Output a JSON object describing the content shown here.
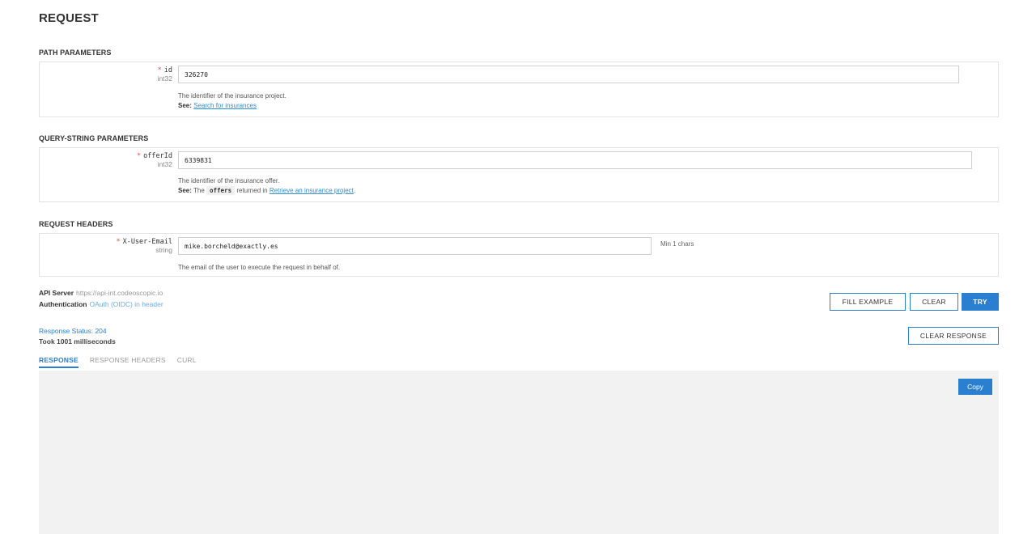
{
  "page": {
    "title": "REQUEST"
  },
  "path_params": {
    "section_title": "PATH PARAMETERS",
    "param": {
      "required_mark": "*",
      "name": "id",
      "type": "int32",
      "value": "326270",
      "description": "The identifier of the insurance project.",
      "see_label": "See:",
      "see_link": "Search for insurances"
    }
  },
  "query_params": {
    "section_title": "QUERY-STRING PARAMETERS",
    "param": {
      "required_mark": "*",
      "name": "offerId",
      "type": "int32",
      "value": "6339831",
      "description": "The identifier of the insurance offer.",
      "see_label": "See:",
      "see_prefix": "The",
      "see_code": "offers",
      "see_middle": "returned in",
      "see_link": "Retrieve an insurance project",
      "see_suffix": "."
    }
  },
  "request_headers": {
    "section_title": "REQUEST HEADERS",
    "param": {
      "required_mark": "*",
      "name": "X-User-Email",
      "type": "string",
      "value": "mike.borcheld@exactly.es",
      "hint": "Min 1 chars",
      "description": "The email of the user to execute the request in behalf of."
    }
  },
  "server_info": {
    "api_server_label": "API Server",
    "api_server_value": "https://api-int.codeoscopic.io",
    "auth_label": "Authentication",
    "auth_value": "OAuth (OIDC) in header"
  },
  "actions": {
    "fill_example": "FILL EXAMPLE",
    "clear": "CLEAR",
    "try": "TRY",
    "clear_response": "CLEAR RESPONSE"
  },
  "response": {
    "status": "Response Status: 204",
    "took": "Took 1001 milliseconds",
    "tabs": [
      "RESPONSE",
      "RESPONSE HEADERS",
      "CURL"
    ],
    "copy_label": "Copy"
  },
  "colors": {
    "accent": "#2a7fd0",
    "required": "#e0534f",
    "link": "#2a8fd8",
    "panel_bg": "#f2f2f2"
  }
}
